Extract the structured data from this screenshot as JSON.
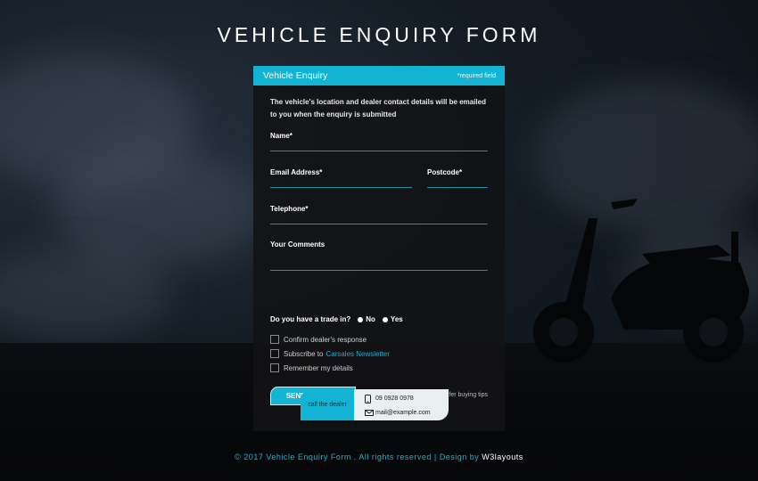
{
  "page": {
    "title": "VEHICLE ENQUIRY FORM"
  },
  "form": {
    "header_title": "Vehicle Enquiry",
    "required_note": "*required field",
    "notice": "The vehicle's location and dealer contact details will be emailed to you when the enquiry is submitted",
    "fields": {
      "name": "Name*",
      "email": "Email Address*",
      "postcode": "Postcode*",
      "telephone": "Telephone*",
      "comments": "Your Comments"
    },
    "trade_in": {
      "question": "Do you have a trade in?",
      "options": [
        "No",
        "Yes"
      ]
    },
    "checkboxes": {
      "confirm": "Confirm dealer's response",
      "subscribe_prefix": "Subscribe to",
      "subscribe_link": "Carsales Newsletter",
      "remember": "Remember my details"
    },
    "send_label": "SEND ENQUIRY",
    "tips_label": "Safer buying tips"
  },
  "dealer": {
    "call_label": "call the dealer",
    "phone": "09 0928 0978",
    "email": "mail@example.com"
  },
  "footer": {
    "text": "© 2017 Vehicle Enquiry Form . All rights reserved | Design by",
    "brand": "W3layouts"
  },
  "colors": {
    "accent": "#13b3d3",
    "card_bg": "#121214",
    "field_line": "#1d8ea3"
  },
  "icons": {
    "phone": "phone-icon",
    "mail": "mail-icon"
  }
}
